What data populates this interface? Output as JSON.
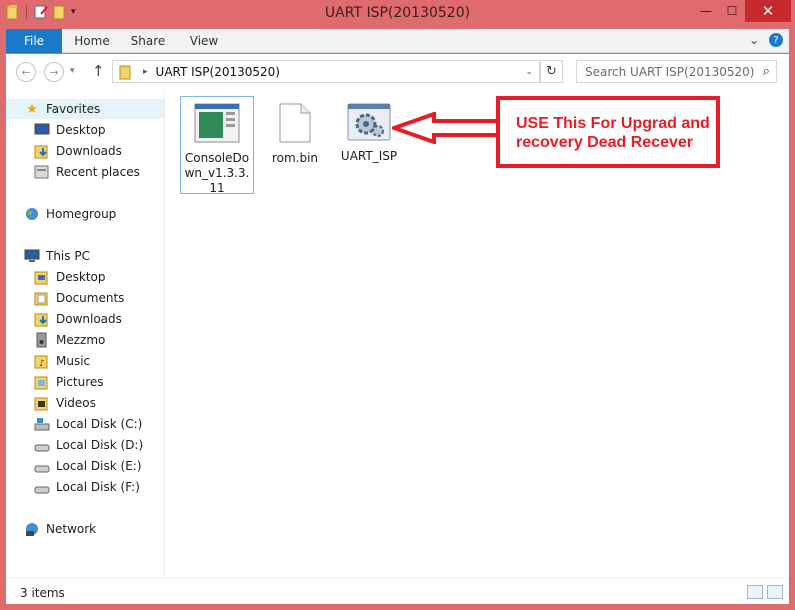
{
  "window": {
    "title": "UART ISP(20130520)",
    "controls": {
      "minimize": "—",
      "maximize": "☐",
      "close": "✕"
    }
  },
  "ribbon": {
    "tabs": [
      "File",
      "Home",
      "Share",
      "View"
    ]
  },
  "address": {
    "path": "UART ISP(20130520)",
    "search_placeholder": "Search UART ISP(20130520)"
  },
  "nav": {
    "favorites": {
      "label": "Favorites",
      "items": [
        "Desktop",
        "Downloads",
        "Recent places"
      ]
    },
    "homegroup": "Homegroup",
    "this_pc": {
      "label": "This PC",
      "items": [
        "Desktop",
        "Documents",
        "Downloads",
        "Mezzmo",
        "Music",
        "Pictures",
        "Videos",
        "Local Disk (C:)",
        "Local Disk (D:)",
        "Local Disk (E:)",
        "Local Disk (F:)"
      ]
    },
    "network": "Network"
  },
  "files": [
    {
      "name": "ConsoleDown_v1.3.3.11",
      "icon": "console-app-icon"
    },
    {
      "name": "rom.bin",
      "icon": "blank-file-icon"
    },
    {
      "name": "UART_ISP",
      "icon": "gear-app-icon"
    }
  ],
  "annotation": {
    "text": "USE This For Upgrad and recovery Dead Recever",
    "color": "#e81d28"
  },
  "status": {
    "count": "3 items"
  },
  "colors": {
    "accent": "#1979ca",
    "titlebar": "#e06b6e",
    "close": "#c7292f"
  }
}
